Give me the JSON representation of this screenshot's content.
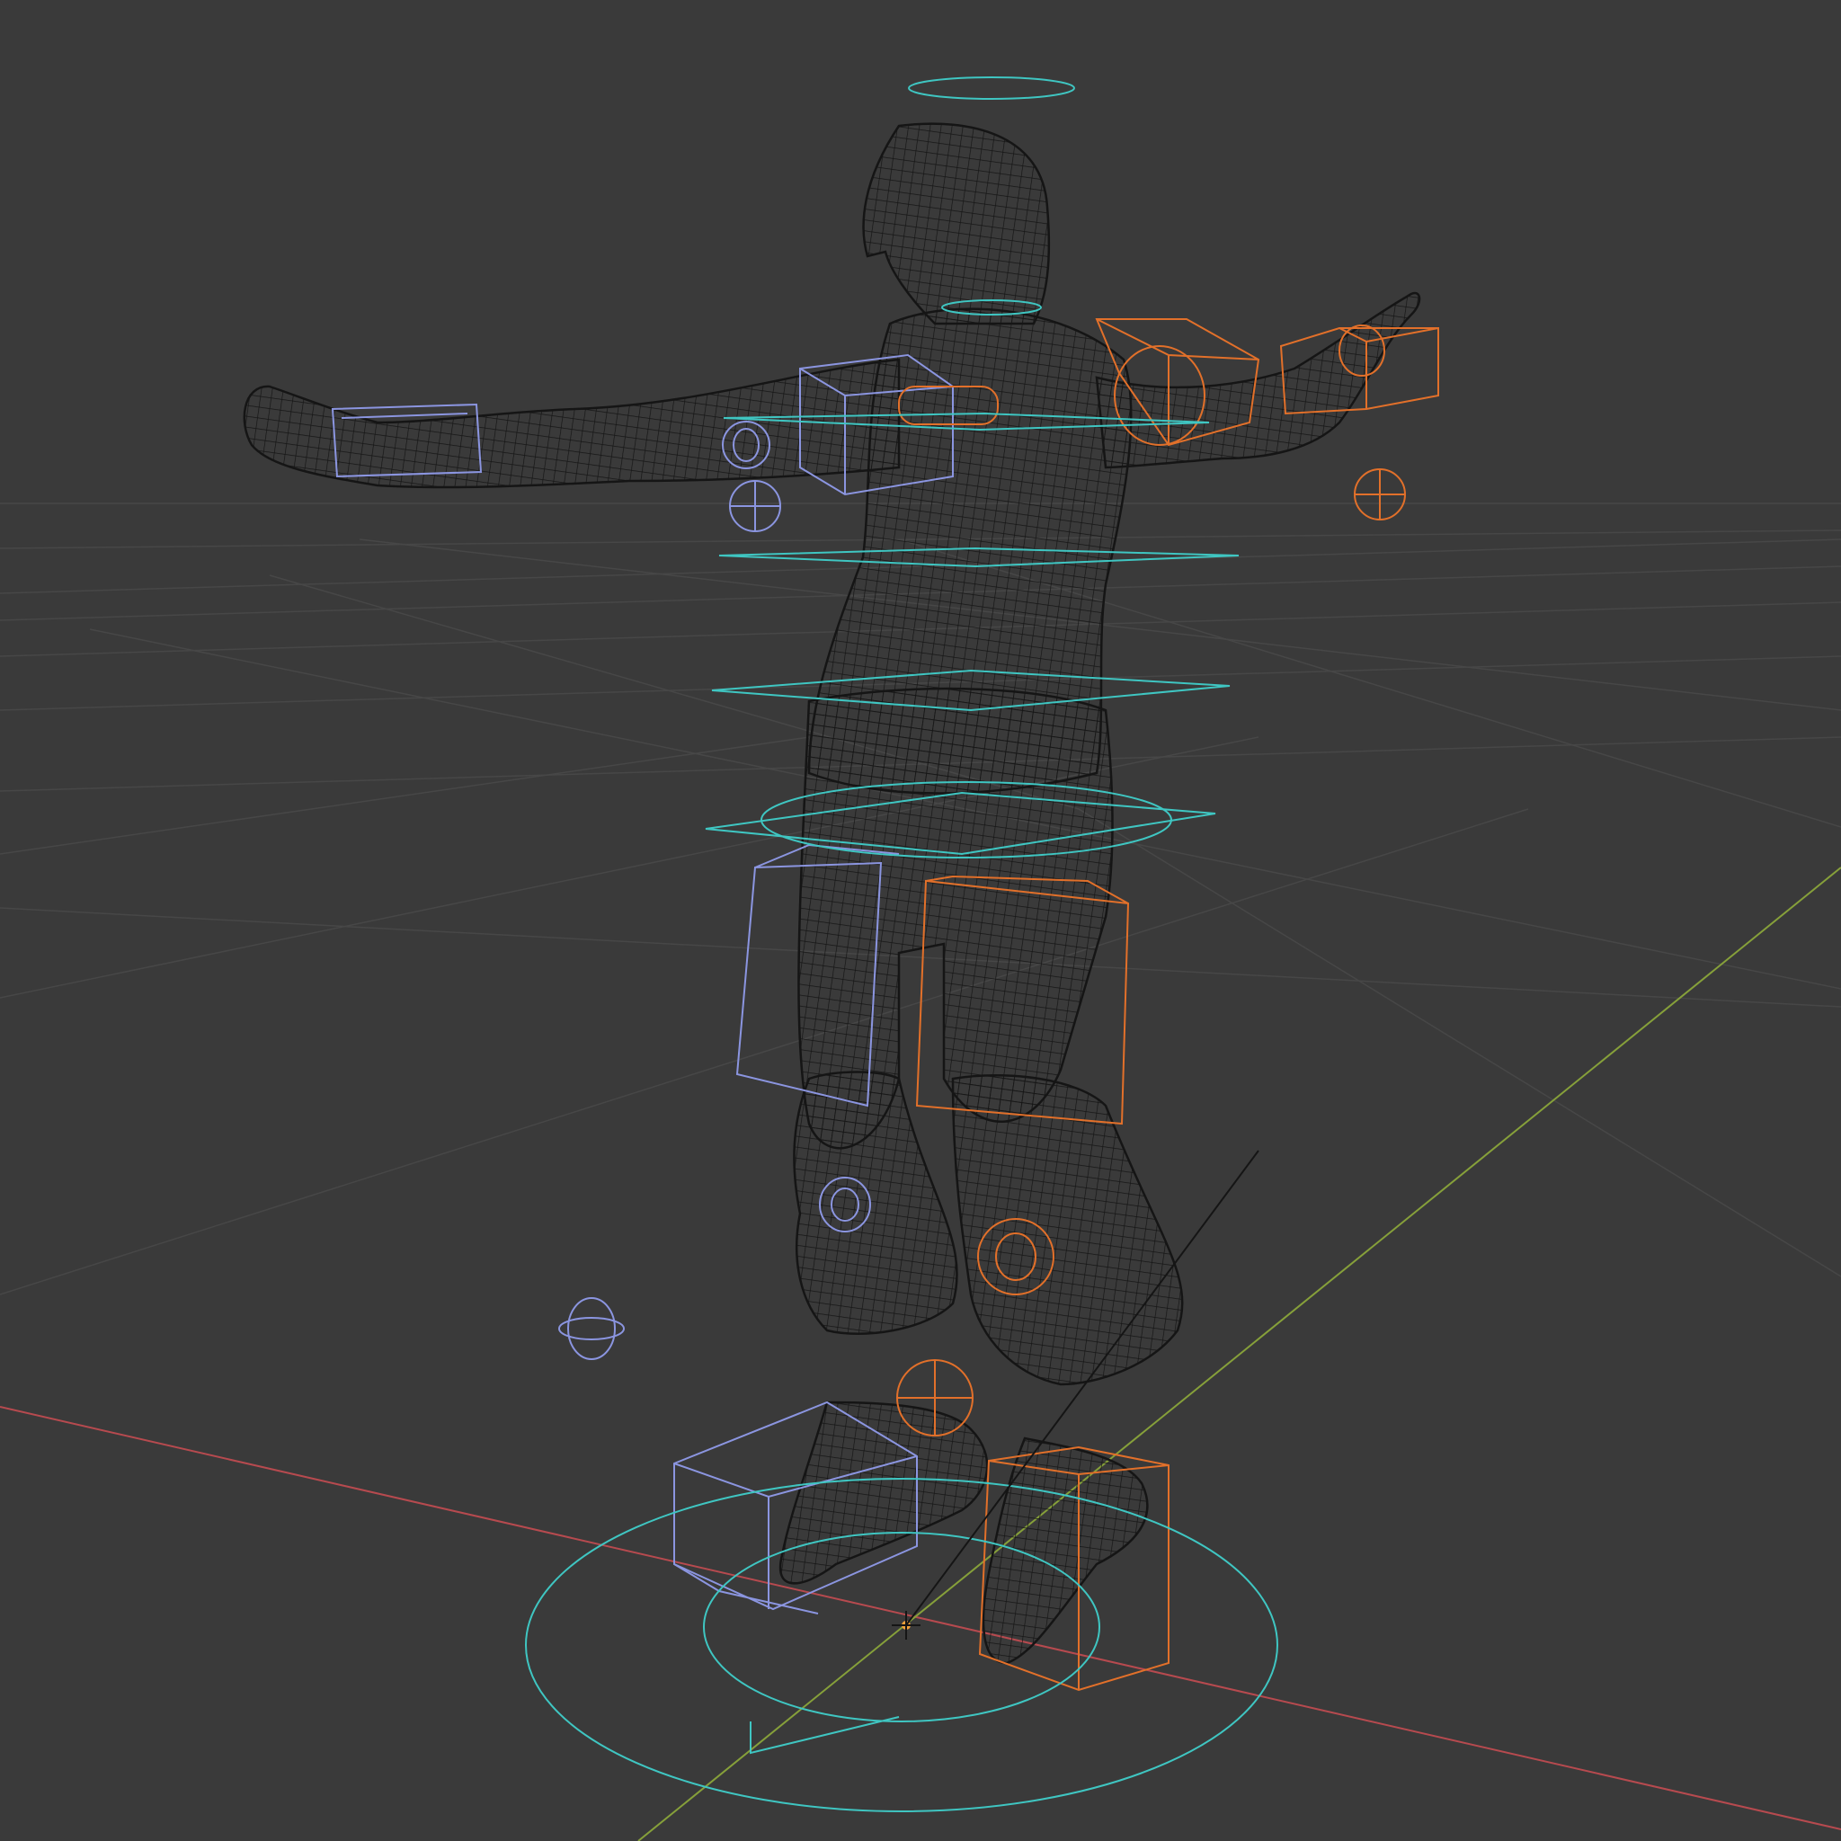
{
  "viewport": {
    "mode": "wireframe",
    "background_color": "#3a3a3a",
    "grid_color": "#474747",
    "x_axis_color": "#b74a4f",
    "y_axis_color": "#86a03a"
  },
  "armature": {
    "left_controls_color": "#8b95e0",
    "right_controls_color": "#e2702a",
    "center_controls_color": "#3fc6c2"
  },
  "mesh": {
    "wire_color": "#151515",
    "fill_color": "#2c2c2c"
  },
  "scene": {
    "origin_marker_color": "#f2a23a"
  }
}
